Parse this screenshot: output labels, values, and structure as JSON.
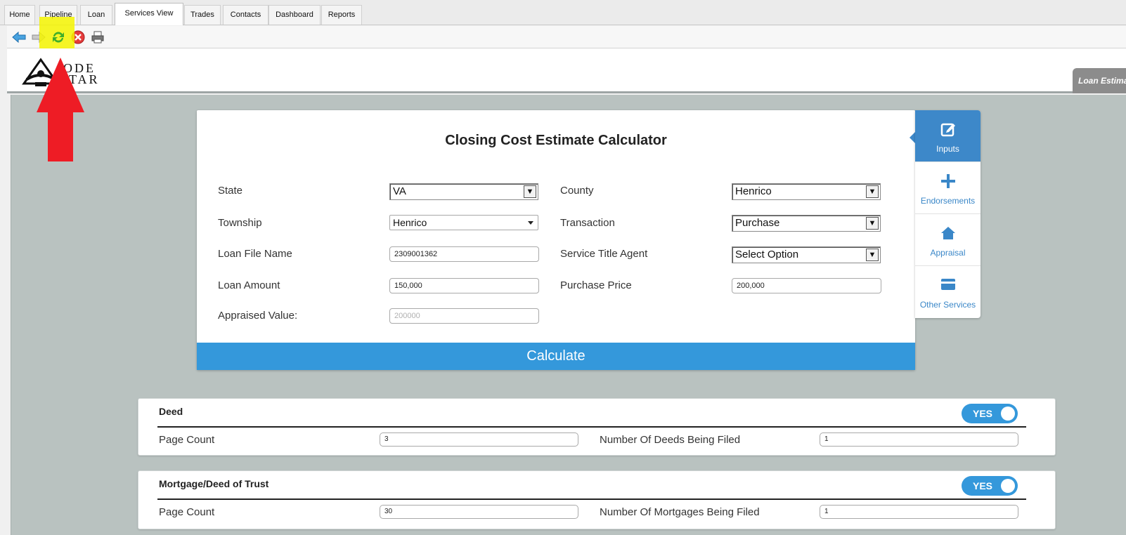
{
  "tabs": [
    {
      "label": "Home"
    },
    {
      "label": "Pipeline"
    },
    {
      "label": "Loan"
    },
    {
      "label": "Services View",
      "active": true
    },
    {
      "label": "Trades"
    },
    {
      "label": "Contacts"
    },
    {
      "label": "Dashboard"
    },
    {
      "label": "Reports"
    }
  ],
  "toolbar": {
    "icons": [
      "back-arrow-icon",
      "forward-arrow-icon",
      "refresh-icon",
      "stop-icon",
      "print-icon"
    ]
  },
  "logo": {
    "line1": "ODE",
    "line2": "TAR"
  },
  "loan_tab": {
    "label": "Loan Estima"
  },
  "calculator": {
    "title": "Closing Cost Estimate Calculator",
    "fields": {
      "state": {
        "label": "State",
        "value": "VA"
      },
      "county": {
        "label": "County",
        "value": "Henrico"
      },
      "township": {
        "label": "Township",
        "value": "Henrico"
      },
      "transaction": {
        "label": "Transaction",
        "value": "Purchase"
      },
      "loan_file_name": {
        "label": "Loan File Name",
        "value": "2309001362"
      },
      "service_title_agent": {
        "label": "Service Title Agent",
        "value": "Select Option"
      },
      "loan_amount": {
        "label": "Loan Amount",
        "value": "150,000"
      },
      "purchase_price": {
        "label": "Purchase Price",
        "value": "200,000"
      },
      "appraised_value": {
        "label": "Appraised Value:",
        "placeholder": "200000"
      }
    },
    "calculate_label": "Calculate"
  },
  "side_menu": [
    {
      "label": "Inputs",
      "icon": "edit-icon",
      "active": true
    },
    {
      "label": "Endorsements",
      "icon": "plus-icon"
    },
    {
      "label": "Appraisal",
      "icon": "home-icon"
    },
    {
      "label": "Other Services",
      "icon": "card-icon"
    }
  ],
  "sections": {
    "deed": {
      "title": "Deed",
      "toggle": "YES",
      "page_count_label": "Page Count",
      "page_count_value": "3",
      "count_label": "Number Of Deeds Being Filed",
      "count_value": "1"
    },
    "mortgage": {
      "title": "Mortgage/Deed of Trust",
      "toggle": "YES",
      "page_count_label": "Page Count",
      "page_count_value": "30",
      "count_label": "Number Of Mortgages Being Filed",
      "count_value": "1"
    }
  },
  "colors": {
    "accent": "#3498db",
    "highlight": "#f4f400",
    "annotation_arrow": "#ee1c25",
    "content_bg": "#b9c2c0"
  }
}
